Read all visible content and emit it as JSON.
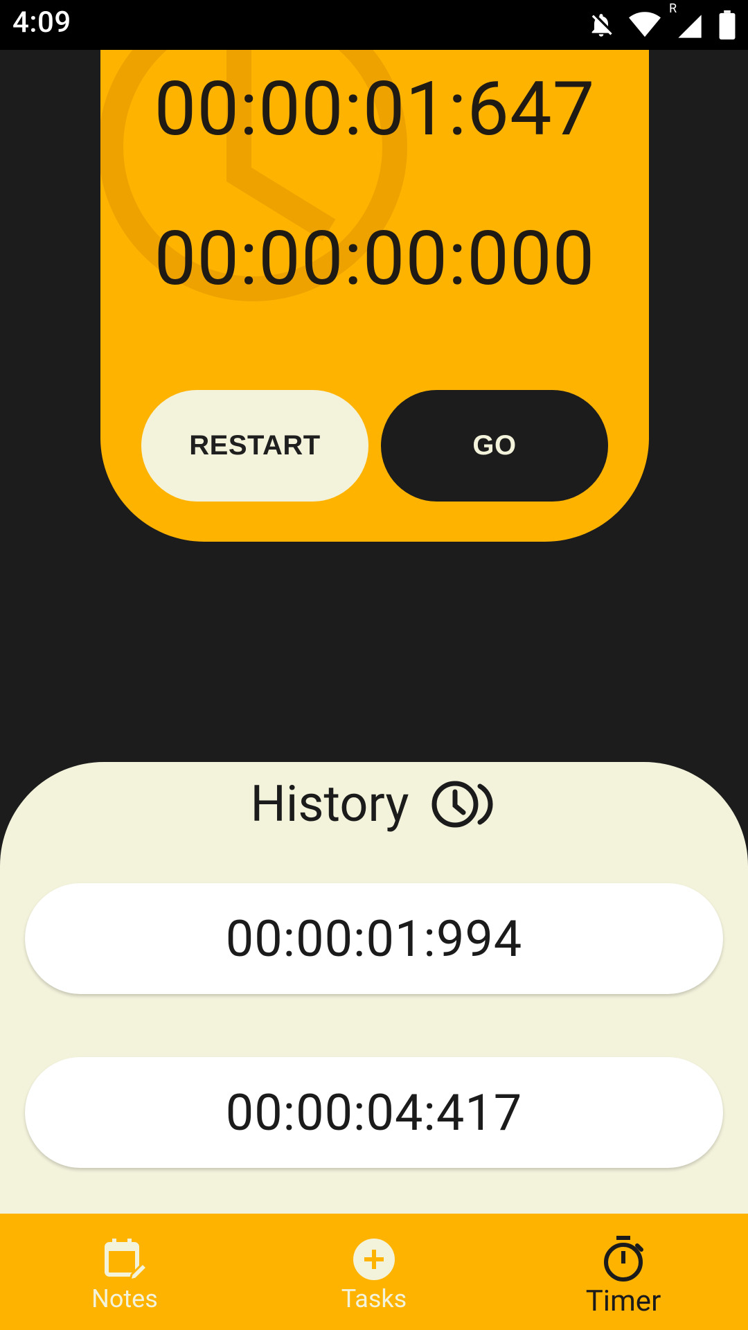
{
  "status_bar": {
    "time": "4:09",
    "icons": [
      "notifications-off-icon",
      "wifi-icon",
      "roaming-signal-icon",
      "battery-icon"
    ],
    "roaming_label": "R"
  },
  "timer": {
    "main_time": "00:00:01:647",
    "lap_time": "00:00:00:000",
    "restart_label": "RESTART",
    "go_label": "GO",
    "background_icon": "clock-watermark-icon"
  },
  "history": {
    "title": "History",
    "icon": "history-icon",
    "items": [
      "00:00:01:994",
      "00:00:04:417"
    ]
  },
  "bottom_nav": {
    "items": [
      {
        "label": "Notes",
        "icon": "calendar-edit-icon"
      },
      {
        "label": "Tasks",
        "icon": "add-circle-icon"
      },
      {
        "label": "Timer",
        "icon": "stopwatch-icon"
      }
    ],
    "active": "Timer"
  },
  "colors": {
    "accent": "#feb300",
    "dark": "#1c1c1c",
    "cream": "#f3f3dc"
  }
}
